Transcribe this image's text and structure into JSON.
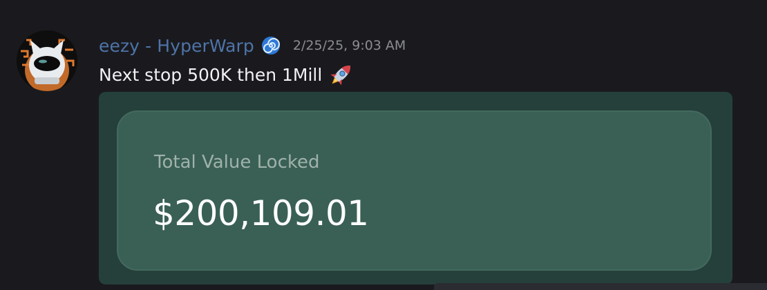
{
  "message": {
    "author": "eezy - HyperWarp",
    "author_badge_icon": "spiral-icon",
    "timestamp": "2/25/25, 9:03 AM",
    "text": "Next stop 500K then 1Mill",
    "text_emoji_icon": "rocket-icon"
  },
  "embed": {
    "card": {
      "label": "Total Value Locked",
      "value": "$200,109.01"
    }
  },
  "colors": {
    "background": "#1a1a1e",
    "username": "#4e74a9",
    "timestamp": "#8b8d93",
    "embed_bg": "#25403a",
    "card_bg": "#3a6055"
  }
}
